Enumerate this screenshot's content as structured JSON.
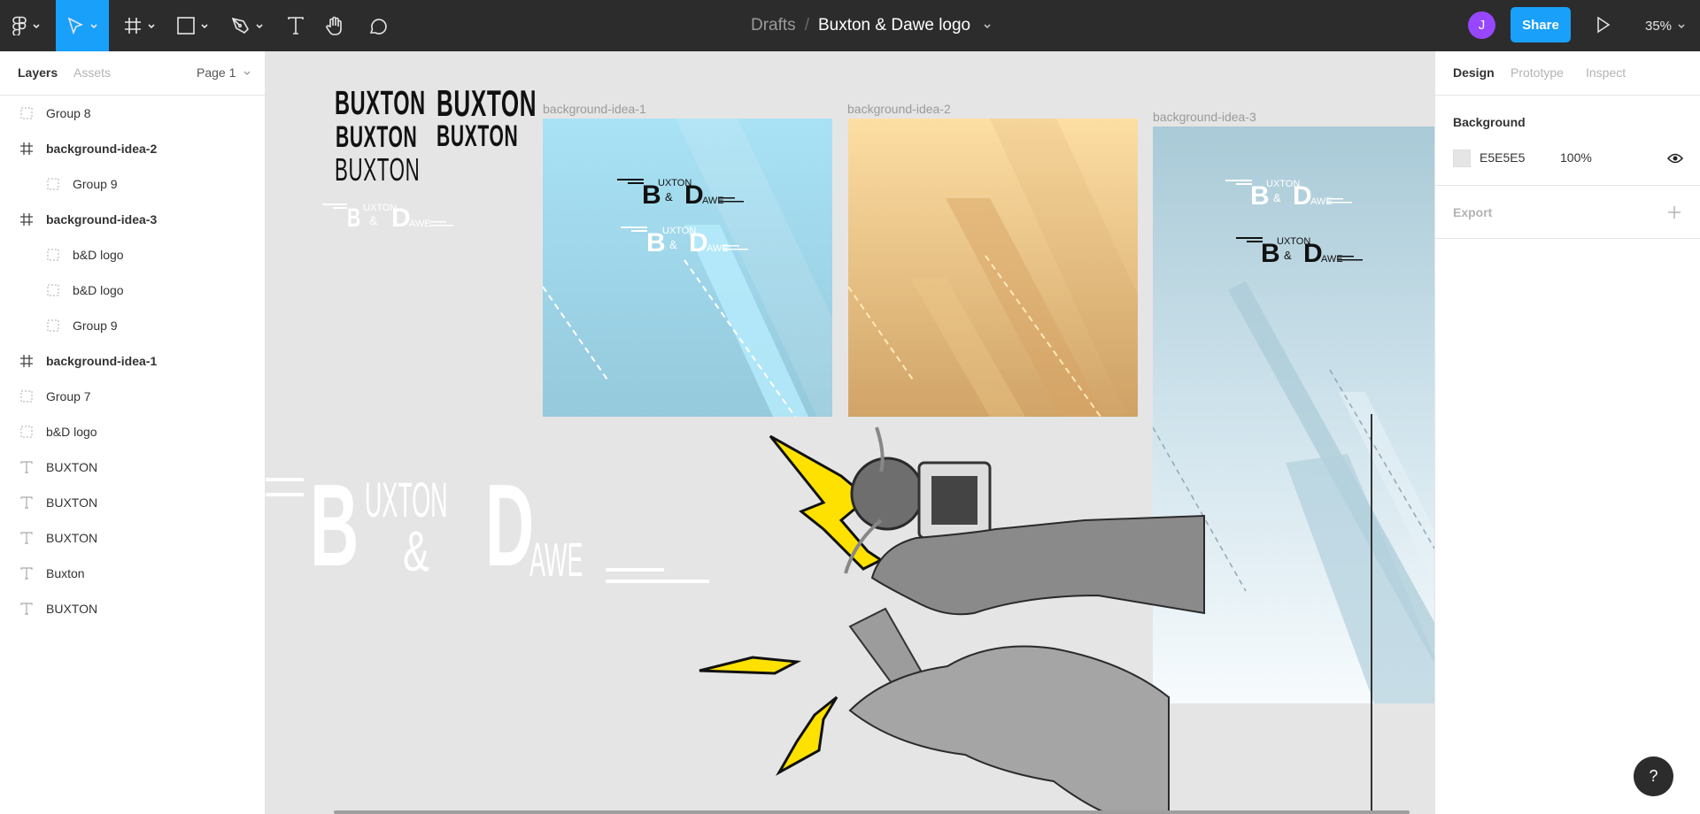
{
  "toolbar": {
    "tools": [
      {
        "name": "main-menu",
        "icon": "figma-icon",
        "has_caret": true
      },
      {
        "name": "move",
        "icon": "move-cursor-icon",
        "has_caret": true,
        "active": true
      },
      {
        "name": "frame",
        "icon": "frame-icon",
        "has_caret": true
      },
      {
        "name": "shape",
        "icon": "rectangle-icon",
        "has_caret": true
      },
      {
        "name": "pen",
        "icon": "pen-icon",
        "has_caret": true
      },
      {
        "name": "text",
        "icon": "text-icon",
        "has_caret": false
      },
      {
        "name": "hand",
        "icon": "hand-icon",
        "has_caret": false
      },
      {
        "name": "comment",
        "icon": "comment-icon",
        "has_caret": false
      }
    ],
    "breadcrumb": {
      "folder": "Drafts",
      "separator": "/",
      "file": "Buxton & Dawe logo"
    },
    "avatar_initial": "J",
    "share_label": "Share",
    "zoom_level": "35%",
    "accent_color": "#18a0fb",
    "avatar_color": "#9747ff"
  },
  "left_panel": {
    "tabs": [
      "Layers",
      "Assets"
    ],
    "active_tab": "Layers",
    "page_selector": "Page 1",
    "layers": [
      {
        "label": "Group 8",
        "type": "group",
        "indent": 0
      },
      {
        "label": "background-idea-2",
        "type": "frame",
        "indent": 0
      },
      {
        "label": "Group 9",
        "type": "group",
        "indent": 1
      },
      {
        "label": "background-idea-3",
        "type": "frame",
        "indent": 0
      },
      {
        "label": "b&D logo",
        "type": "group",
        "indent": 1
      },
      {
        "label": "b&D logo",
        "type": "group",
        "indent": 1
      },
      {
        "label": "Group 9",
        "type": "group",
        "indent": 1
      },
      {
        "label": "background-idea-1",
        "type": "frame",
        "indent": 0
      },
      {
        "label": "Group 7",
        "type": "group",
        "indent": 0
      },
      {
        "label": "b&D logo",
        "type": "group",
        "indent": 0
      },
      {
        "label": "BUXTON",
        "type": "text",
        "indent": 0
      },
      {
        "label": "BUXTON",
        "type": "text",
        "indent": 0
      },
      {
        "label": "BUXTON",
        "type": "text",
        "indent": 0
      },
      {
        "label": "Buxton",
        "type": "text",
        "indent": 0
      },
      {
        "label": "BUXTON",
        "type": "text",
        "indent": 0
      }
    ]
  },
  "canvas": {
    "background": "#e5e5e5",
    "text_samples": [
      "BUXTON",
      "BUXTON",
      "BUXTON",
      "BUXTON",
      "BUXTON"
    ],
    "logo": {
      "b": "B",
      "uxton": "UXTON",
      "amp": "&",
      "d": "D",
      "awe": "AWE"
    },
    "frames": [
      {
        "label": "background-idea-1",
        "colors": [
          "#a9e2f5",
          "#95c9dc"
        ]
      },
      {
        "label": "background-idea-2",
        "colors": [
          "#fddea3",
          "#d1a468"
        ]
      },
      {
        "label": "background-idea-3",
        "colors": [
          "#a9cad7",
          "#f7fbfd"
        ]
      }
    ]
  },
  "right_panel": {
    "tabs": [
      "Design",
      "Prototype",
      "Inspect"
    ],
    "active_tab": "Design",
    "background_section": {
      "title": "Background",
      "hex": "E5E5E5",
      "opacity": "100%",
      "swatch": "#e5e5e5"
    },
    "export_section": {
      "title": "Export"
    }
  },
  "help_label": "?"
}
